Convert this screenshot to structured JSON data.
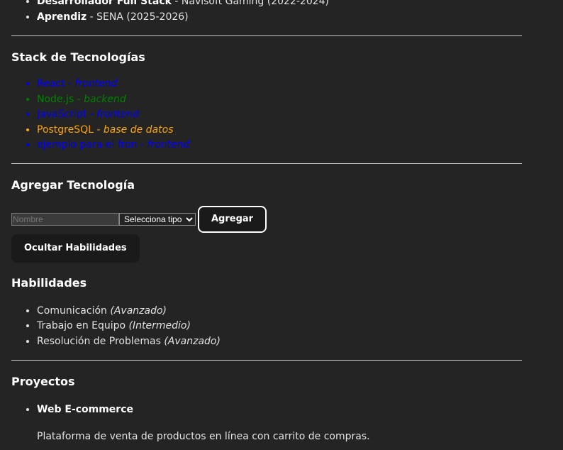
{
  "experience": [
    {
      "role": "Desarrollador Full Stack",
      "detail": " - Navisoft Gaming (2022-2024)"
    },
    {
      "role": "Aprendiz",
      "detail": " - SENA (2025-2026)"
    }
  ],
  "stack": {
    "title": "Stack de Tecnologías",
    "items": [
      {
        "name": "React",
        "type": "frontend",
        "color": "#0000ff"
      },
      {
        "name": "Node.js",
        "type": "backend",
        "color": "#008000"
      },
      {
        "name": "JavaScript",
        "type": "frontend",
        "color": "#0000ff"
      },
      {
        "name": "PostgreSQL",
        "type": "base de datos",
        "color": "#ffa500"
      },
      {
        "name": "ejemplo para el fron",
        "type": "frontend",
        "color": "#0000ff"
      }
    ]
  },
  "add": {
    "title": "Agregar Tecnología",
    "placeholder": "Nombre",
    "select": "Selecciona tipo",
    "button": "Agregar",
    "toggle": "Ocultar Habilidades"
  },
  "skills": {
    "title": "Habilidades",
    "items": [
      {
        "name": "Comunicación",
        "level": "(Avanzado)"
      },
      {
        "name": "Trabajo en Equipo",
        "level": "(Intermedio)"
      },
      {
        "name": "Resolución de Problemas",
        "level": "(Avanzado)"
      }
    ]
  },
  "projects": {
    "title": "Proyectos",
    "items": [
      {
        "name": "Web E-commerce",
        "desc": "Plataforma de venta de productos en línea con carrito de compras."
      }
    ]
  }
}
